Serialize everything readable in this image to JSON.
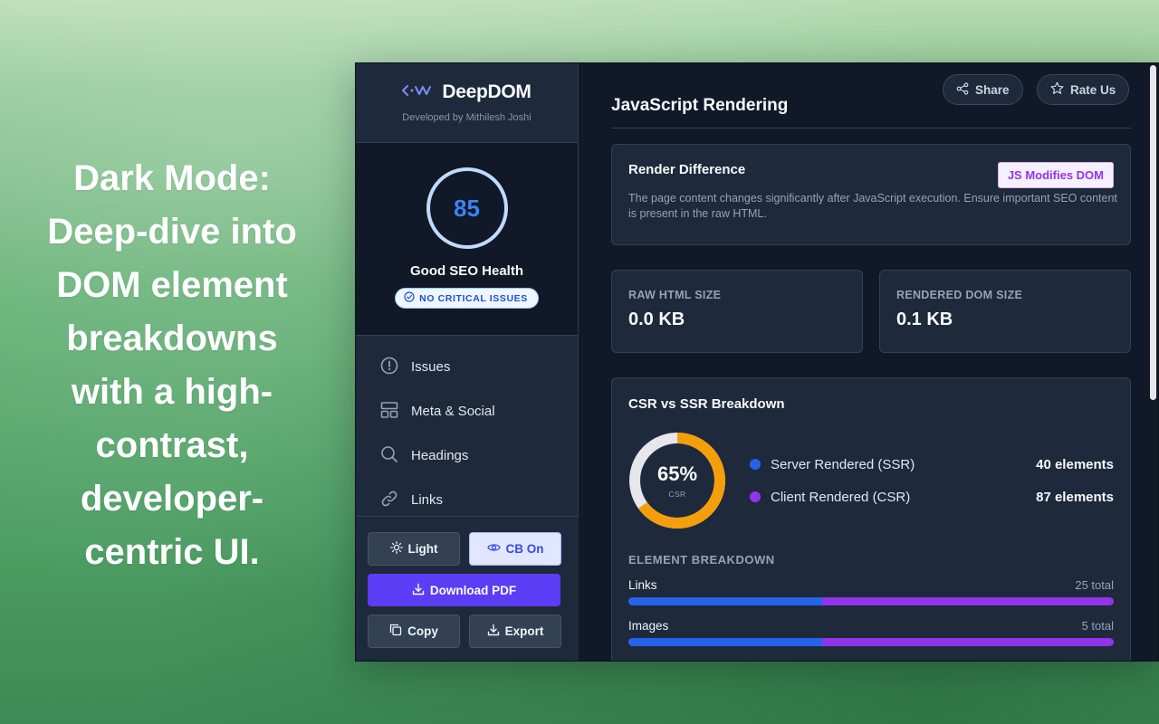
{
  "promo": {
    "lines": [
      "Dark Mode:",
      "Deep-dive into",
      "DOM element",
      "breakdowns",
      "with a high-",
      "contrast,",
      "developer-",
      "centric UI."
    ]
  },
  "brand": {
    "name": "DeepDOM",
    "subtitle": "Developed by Mithilesh Joshi",
    "logo_icon": "code-arrows-icon"
  },
  "score": {
    "value": "85",
    "label": "Good SEO Health",
    "badge": "NO CRITICAL ISSUES",
    "badge_icon": "check-circle-icon"
  },
  "nav": {
    "items": [
      {
        "label": "Issues",
        "icon": "alert-circle-icon"
      },
      {
        "label": "Meta & Social",
        "icon": "layout-icon"
      },
      {
        "label": "Headings",
        "icon": "search-icon"
      },
      {
        "label": "Links",
        "icon": "link-icon"
      }
    ]
  },
  "footer": {
    "light_label": "Light",
    "cb_label": "CB On",
    "download_label": "Download PDF",
    "copy_label": "Copy",
    "export_label": "Export"
  },
  "header": {
    "title": "JavaScript Rendering",
    "share_label": "Share",
    "rate_label": "Rate Us"
  },
  "render_diff": {
    "title": "Render Difference",
    "badge": "JS Modifies DOM",
    "text": "The page content changes significantly after JavaScript execution. Ensure important SEO content is present in the raw HTML."
  },
  "stats": {
    "raw_label": "RAW HTML SIZE",
    "raw_value": "0.0 KB",
    "rendered_label": "RENDERED DOM SIZE",
    "rendered_value": "0.1 KB"
  },
  "breakdown": {
    "title": "CSR vs SSR Breakdown",
    "donut_pct": "65%",
    "donut_sub": "CSR",
    "csr_fraction": 0.65,
    "ssr_label": "Server Rendered (SSR)",
    "ssr_count": "40 elements",
    "csr_label": "Client Rendered (CSR)",
    "csr_count": "87 elements",
    "section_label": "ELEMENT BREAKDOWN",
    "rows": [
      {
        "name": "Links",
        "total": "25 total",
        "ssr_fraction": 0.4
      },
      {
        "name": "Images",
        "total": "5 total",
        "ssr_fraction": 0.4
      }
    ]
  },
  "colors": {
    "ssr": "#2563eb",
    "csr": "#9333ea",
    "donut_csr": "#f59e0b",
    "donut_track": "#e5e7eb",
    "accent": "#5b3df5"
  }
}
